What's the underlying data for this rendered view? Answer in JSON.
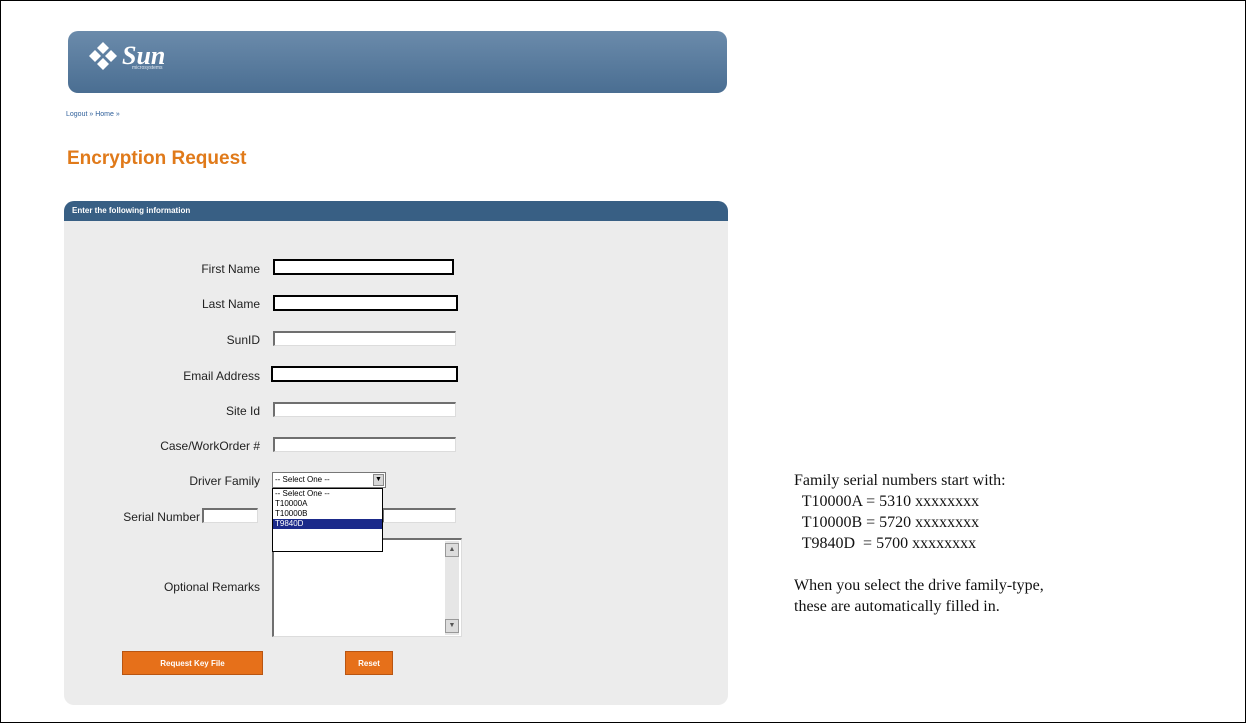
{
  "header": {
    "logo_text": "Sun",
    "logo_sub": "microsystems"
  },
  "breadcrumb": {
    "logout": "Logout »",
    "home": "Home »"
  },
  "page_title": "Encryption Request",
  "form": {
    "header": "Enter the following information",
    "first_name_label": "First Name",
    "last_name_label": "Last Name",
    "sunid_label": "SunID",
    "email_label": "Email Address",
    "site_id_label": "Site Id",
    "case_label": "Case/WorkOrder #",
    "driver_family_label": "Driver Family",
    "serial_label": "Serial Number",
    "remarks_label": "Optional Remarks",
    "driver_family_selected": "-- Select One --",
    "driver_family_options": [
      "-- Select One --",
      "T10000A",
      "T10000B",
      "T9840D"
    ],
    "highlighted_option": "T9840D",
    "request_button": "Request Key File",
    "reset_button": "Reset"
  },
  "side_note": {
    "line1": "Family serial numbers start with:",
    "line2": "  T10000A = 5310 xxxxxxxx",
    "line3": "  T10000B = 5720 xxxxxxxx",
    "line4": "  T9840D  = 5700 xxxxxxxx",
    "line5": "When you select the drive family-type,",
    "line6": "these are automatically filled in."
  },
  "colors": {
    "banner": "#4a6e92",
    "title": "#e07a1a",
    "panel_header": "#385f84",
    "button": "#e6701a",
    "highlight": "#1b2a8a"
  }
}
